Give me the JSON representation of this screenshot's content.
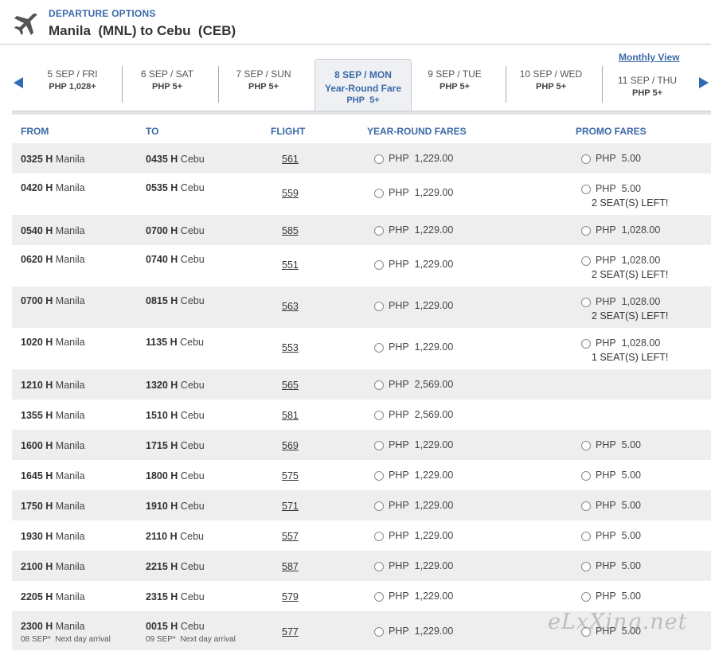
{
  "header": {
    "label": "DEPARTURE OPTIONS",
    "route": "Manila  (MNL) to Cebu  (CEB)"
  },
  "monthly_view": "Monthly View",
  "dates": [
    {
      "date": "5 SEP / FRI",
      "price": "PHP 1,028+"
    },
    {
      "date": "6 SEP / SAT",
      "price": "PHP 5+"
    },
    {
      "date": "7 SEP / SUN",
      "price": "PHP 5+"
    },
    {
      "date": "8 SEP / MON",
      "fare_type": "Year-Round Fare",
      "price": "PHP  5+",
      "active": true
    },
    {
      "date": "9 SEP / TUE",
      "price": "PHP 5+"
    },
    {
      "date": "10 SEP / WED",
      "price": "PHP 5+"
    },
    {
      "date": "11 SEP / THU",
      "price": "PHP 5+"
    }
  ],
  "columns": {
    "from": "FROM",
    "to": "TO",
    "flight": "FLIGHT",
    "yearround": "YEAR-ROUND FARES",
    "promo": "PROMO FARES"
  },
  "flights": [
    {
      "dep": "0325 H",
      "from": "Manila",
      "arr": "0435 H",
      "to": "Cebu",
      "flight": "561",
      "yr": "PHP  1,229.00",
      "promo": "PHP  5.00",
      "seats": ""
    },
    {
      "dep": "0420 H",
      "from": "Manila",
      "arr": "0535 H",
      "to": "Cebu",
      "flight": "559",
      "yr": "PHP  1,229.00",
      "promo": "PHP  5.00",
      "seats": "2 SEAT(S) LEFT!"
    },
    {
      "dep": "0540 H",
      "from": "Manila",
      "arr": "0700 H",
      "to": "Cebu",
      "flight": "585",
      "yr": "PHP  1,229.00",
      "promo": "PHP  1,028.00",
      "seats": ""
    },
    {
      "dep": "0620 H",
      "from": "Manila",
      "arr": "0740 H",
      "to": "Cebu",
      "flight": "551",
      "yr": "PHP  1,229.00",
      "promo": "PHP  1,028.00",
      "seats": "2 SEAT(S) LEFT!"
    },
    {
      "dep": "0700 H",
      "from": "Manila",
      "arr": "0815 H",
      "to": "Cebu",
      "flight": "563",
      "yr": "PHP  1,229.00",
      "promo": "PHP  1,028.00",
      "seats": "2 SEAT(S) LEFT!"
    },
    {
      "dep": "1020 H",
      "from": "Manila",
      "arr": "1135 H",
      "to": "Cebu",
      "flight": "553",
      "yr": "PHP  1,229.00",
      "promo": "PHP  1,028.00",
      "seats": "1 SEAT(S) LEFT!"
    },
    {
      "dep": "1210 H",
      "from": "Manila",
      "arr": "1320 H",
      "to": "Cebu",
      "flight": "565",
      "yr": "PHP  2,569.00",
      "promo": "",
      "seats": ""
    },
    {
      "dep": "1355 H",
      "from": "Manila",
      "arr": "1510 H",
      "to": "Cebu",
      "flight": "581",
      "yr": "PHP  2,569.00",
      "promo": "",
      "seats": ""
    },
    {
      "dep": "1600 H",
      "from": "Manila",
      "arr": "1715 H",
      "to": "Cebu",
      "flight": "569",
      "yr": "PHP  1,229.00",
      "promo": "PHP  5.00",
      "seats": ""
    },
    {
      "dep": "1645 H",
      "from": "Manila",
      "arr": "1800 H",
      "to": "Cebu",
      "flight": "575",
      "yr": "PHP  1,229.00",
      "promo": "PHP  5.00",
      "seats": ""
    },
    {
      "dep": "1750 H",
      "from": "Manila",
      "arr": "1910 H",
      "to": "Cebu",
      "flight": "571",
      "yr": "PHP  1,229.00",
      "promo": "PHP  5.00",
      "seats": ""
    },
    {
      "dep": "1930 H",
      "from": "Manila",
      "arr": "2110 H",
      "to": "Cebu",
      "flight": "557",
      "yr": "PHP  1,229.00",
      "promo": "PHP  5.00",
      "seats": ""
    },
    {
      "dep": "2100 H",
      "from": "Manila",
      "arr": "2215 H",
      "to": "Cebu",
      "flight": "587",
      "yr": "PHP  1,229.00",
      "promo": "PHP  5.00",
      "seats": ""
    },
    {
      "dep": "2205 H",
      "from": "Manila",
      "arr": "2315 H",
      "to": "Cebu",
      "flight": "579",
      "yr": "PHP  1,229.00",
      "promo": "PHP  5.00",
      "seats": ""
    },
    {
      "dep": "2300 H",
      "from": "Manila",
      "arr": "0015 H",
      "to": "Cebu",
      "flight": "577",
      "yr": "PHP  1,229.00",
      "promo": "PHP  5.00",
      "seats": "",
      "dep_note": "08 SEP*  Next day arrival",
      "arr_note": "09 SEP*  Next day arrival"
    }
  ],
  "watermark": "eLxXing.net",
  "colors": {
    "accent": "#3b6aa8",
    "arrow": "#2f6bb5",
    "row_alt": "#eeeeee"
  }
}
